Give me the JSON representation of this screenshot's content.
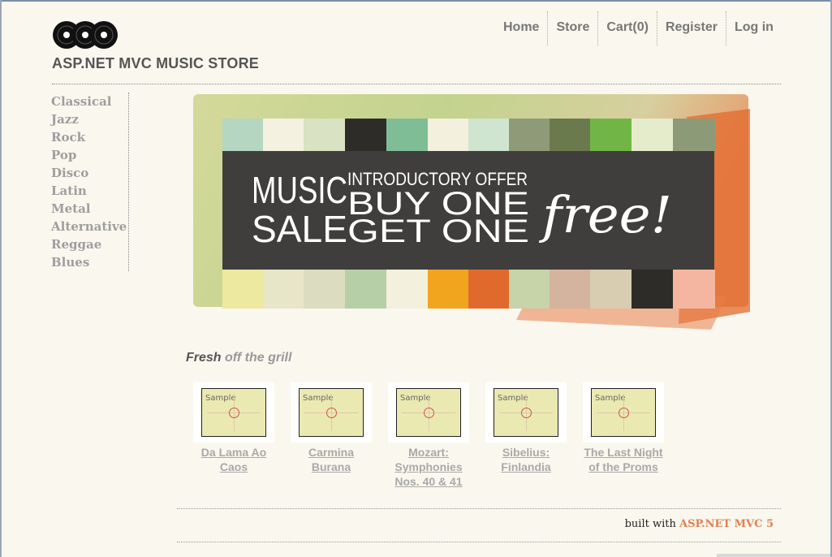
{
  "header": {
    "title": "ASP.NET MVC MUSIC STORE",
    "logo_icon": "vinyl-records-icon"
  },
  "nav": [
    {
      "label": "Home"
    },
    {
      "label": "Store"
    },
    {
      "label": "Cart(0)"
    },
    {
      "label": "Register"
    },
    {
      "label": "Log in"
    }
  ],
  "genres": [
    "Classical",
    "Jazz",
    "Rock",
    "Pop",
    "Disco",
    "Latin",
    "Metal",
    "Alternative",
    "Reggae",
    "Blues"
  ],
  "banner": {
    "music": "MUSIC",
    "sale": "SALE",
    "intro": "INTRODUCTORY OFFER",
    "buy": "BUY ONE",
    "get": "GET ONE",
    "free": "free!",
    "colors": {
      "panel": "#3f3e3c",
      "accent_orange": "#e0642a",
      "accent_green": "#9ebd5a"
    }
  },
  "fresh": {
    "word1": "Fresh",
    "word2": "off the grill"
  },
  "albums": [
    {
      "title": "Da Lama Ao Caos",
      "thumb_label": "Sample"
    },
    {
      "title": "Carmina Burana",
      "thumb_label": "Sample"
    },
    {
      "title": "Mozart: Symphonies Nos. 40 & 41",
      "thumb_label": "Sample"
    },
    {
      "title": "Sibelius: Finlandia",
      "thumb_label": "Sample"
    },
    {
      "title": "The Last Night of the Proms",
      "thumb_label": "Sample"
    }
  ],
  "footer": {
    "prefix": "built with",
    "link": "ASP.NET MVC 5"
  }
}
